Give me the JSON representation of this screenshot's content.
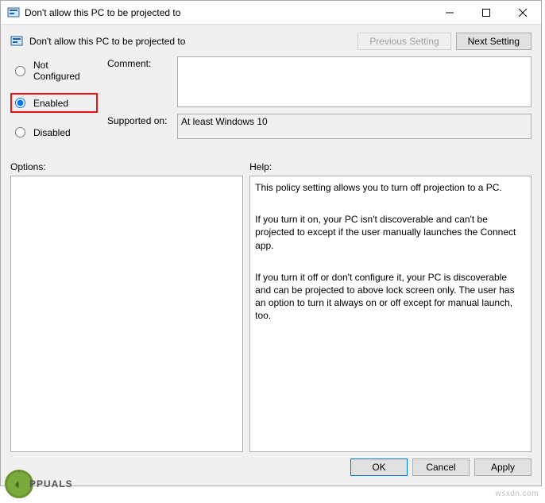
{
  "titlebar": {
    "title": "Don't allow this PC to be projected to"
  },
  "header": {
    "title": "Don't allow this PC to be projected to",
    "prev": "Previous Setting",
    "next": "Next Setting"
  },
  "radio": {
    "not_configured": "Not Configured",
    "enabled": "Enabled",
    "disabled": "Disabled",
    "selected": "enabled"
  },
  "fields": {
    "comment_label": "Comment:",
    "comment_value": "",
    "supported_label": "Supported on:",
    "supported_value": "At least Windows 10"
  },
  "lower": {
    "options_label": "Options:",
    "help_label": "Help:",
    "help_p1": "This policy setting allows you to turn off projection to a PC.",
    "help_p2": "If you turn it on, your PC isn't discoverable and can't be projected to except if the user manually launches the Connect app.",
    "help_p3": "If you turn it off or don't configure it, your PC is discoverable and can be projected to above lock screen only. The user has an option to turn it always on or off except for manual launch, too."
  },
  "footer": {
    "ok": "OK",
    "cancel": "Cancel",
    "apply": "Apply"
  },
  "watermark": "wsxdn.com",
  "brand": "PPUALS"
}
